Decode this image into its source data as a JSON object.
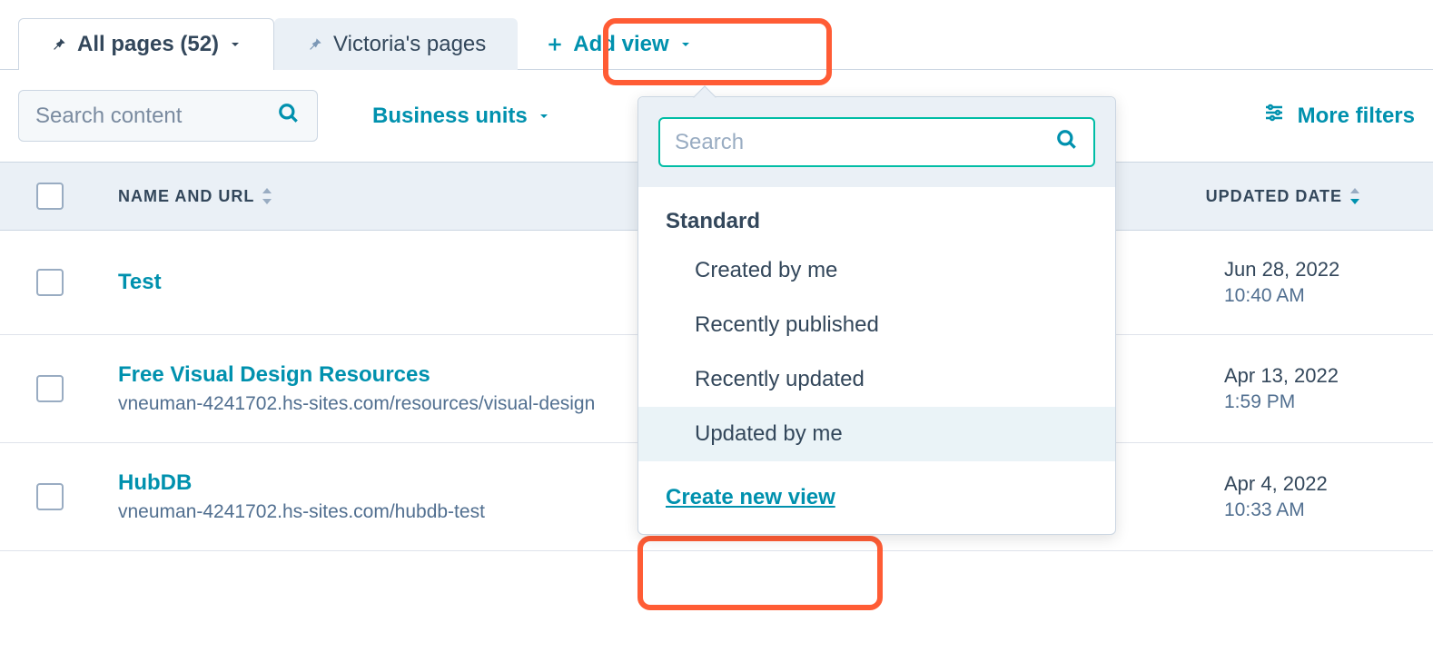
{
  "tabs": {
    "all_pages": "All pages (52)",
    "victoria": "Victoria's pages",
    "add_view": "Add view"
  },
  "filters": {
    "search_placeholder": "Search content",
    "business_units": "Business units",
    "more_filters": "More filters"
  },
  "columns": {
    "name": "NAME AND URL",
    "updated": "UPDATED DATE"
  },
  "rows": [
    {
      "title": "Test",
      "url": "",
      "date": "Jun 28, 2022",
      "time": "10:40 AM"
    },
    {
      "title": "Free Visual Design Resources",
      "url": "vneuman-4241702.hs-sites.com/resources/visual-design",
      "date": "Apr 13, 2022",
      "time": "1:59 PM"
    },
    {
      "title": "HubDB",
      "url": "vneuman-4241702.hs-sites.com/hubdb-test",
      "date": "Apr 4, 2022",
      "time": "10:33 AM"
    }
  ],
  "dropdown": {
    "search_placeholder": "Search",
    "section": "Standard",
    "items": [
      "Created by me",
      "Recently published",
      "Recently updated",
      "Updated by me"
    ],
    "create": "Create new view"
  }
}
